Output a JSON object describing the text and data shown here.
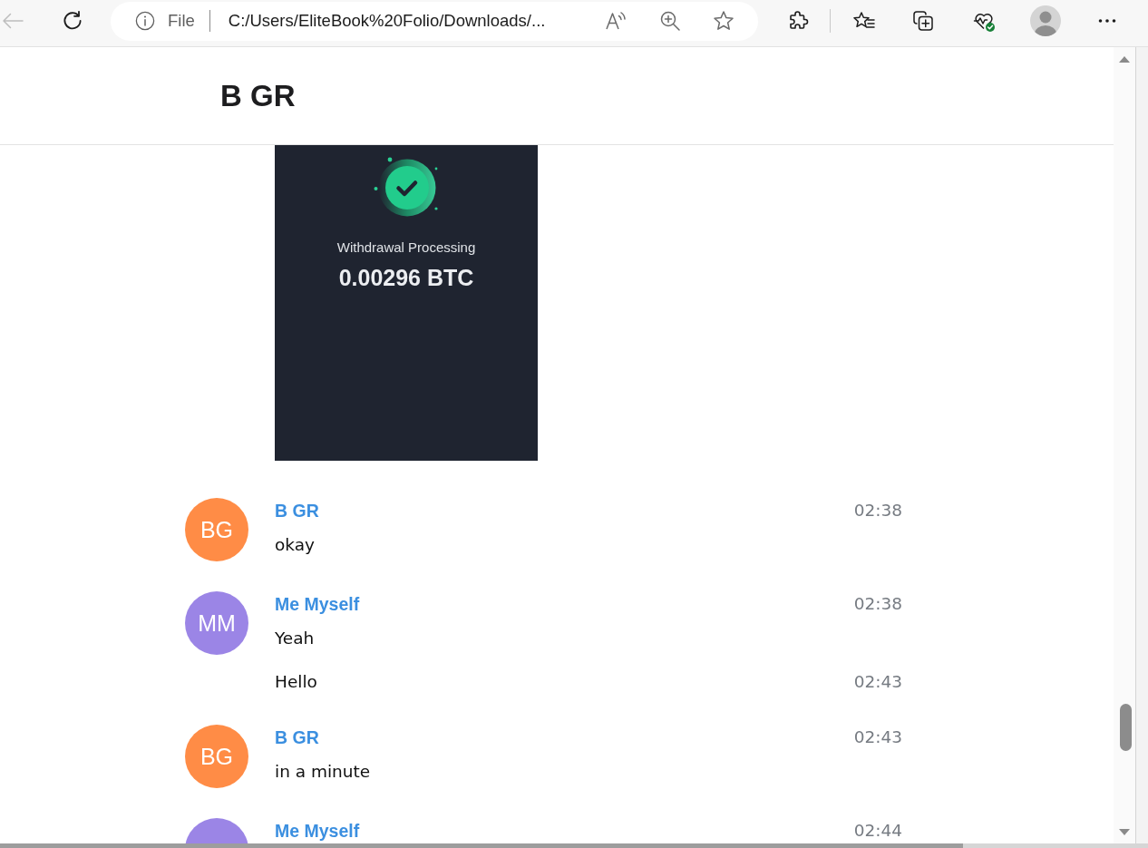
{
  "browser": {
    "back": {
      "disabled": true
    },
    "address_bar": {
      "scheme": "File",
      "url": "C:/Users/EliteBook%20Folio/Downloads/..."
    }
  },
  "chat": {
    "title": "B GR"
  },
  "attachment": {
    "caption": "Withdrawal Processing",
    "amount": "0.00296 BTC"
  },
  "messages": [
    {
      "author": "B GR",
      "time": "02:38",
      "avatar": {
        "initials": "BG",
        "color": "#ff8c46",
        "cut": false
      },
      "lines": [
        {
          "text": "okay"
        }
      ]
    },
    {
      "author": "Me Myself",
      "time": "02:38",
      "avatar": {
        "initials": "MM",
        "color": "#9b85e6",
        "cut": false
      },
      "lines": [
        {
          "text": "Yeah"
        },
        {
          "text": "Hello",
          "time": "02:43"
        }
      ]
    },
    {
      "author": "B GR",
      "time": "02:43",
      "avatar": {
        "initials": "BG",
        "color": "#ff8c46",
        "cut": false
      },
      "lines": [
        {
          "text": "in a minute"
        }
      ]
    },
    {
      "author": "Me Myself",
      "time": "02:44",
      "avatar": {
        "color": "#9b85e6",
        "cut": true
      }
    }
  ]
}
